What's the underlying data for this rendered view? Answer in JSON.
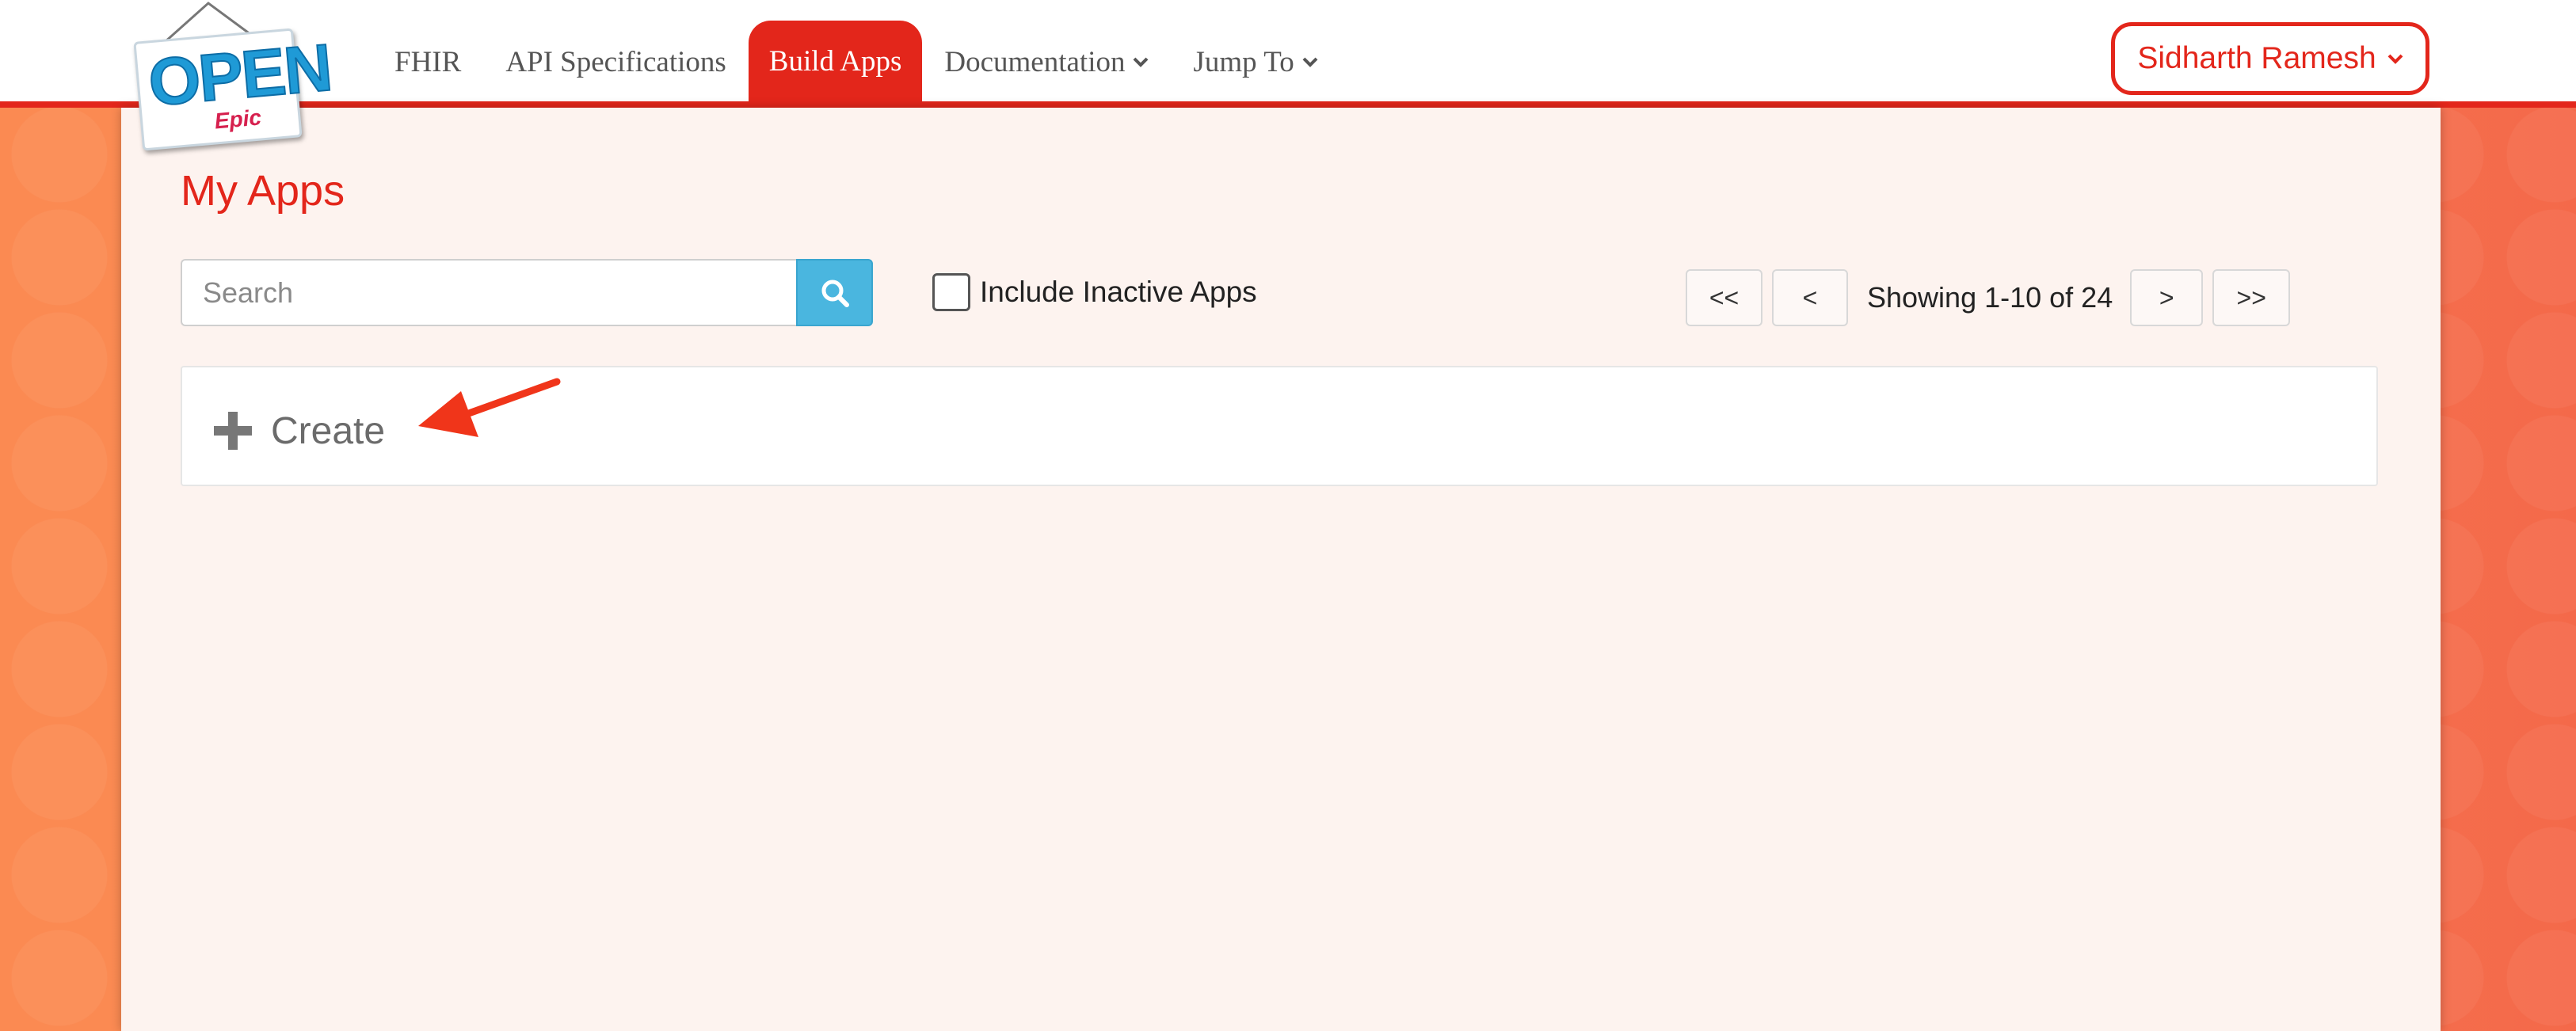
{
  "nav": {
    "logo_text": "OPEN",
    "logo_sub": "Epic",
    "items": [
      {
        "label": "FHIR"
      },
      {
        "label": "API Specifications"
      },
      {
        "label": "Build Apps"
      },
      {
        "label": "Documentation"
      },
      {
        "label": "Jump To"
      }
    ],
    "active_index": 2,
    "user": "Sidharth Ramesh"
  },
  "main": {
    "title": "My Apps",
    "search": {
      "placeholder": "Search",
      "value": ""
    },
    "include_inactive_label": "Include Inactive Apps",
    "include_inactive_checked": false,
    "pager": {
      "first": "<<",
      "prev": "<",
      "status": "Showing 1-10 of 24",
      "next": ">",
      "last": ">>"
    },
    "create_label": "Create"
  },
  "colors": {
    "brand_red": "#e3261b",
    "search_button": "#4ab6df",
    "background_orange": "#f98b55"
  }
}
